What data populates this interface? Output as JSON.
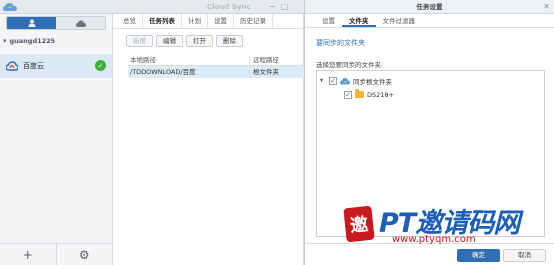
{
  "app": {
    "title": "Cloud Sync"
  },
  "sidebar": {
    "account": "guangd1225",
    "connection": {
      "name": "百度云",
      "status": "ok"
    }
  },
  "middle": {
    "tabs": [
      "总览",
      "任务列表",
      "计划",
      "设置",
      "历史记录"
    ],
    "active_tab": "任务列表",
    "toolbar": [
      "新增",
      "编辑",
      "打开",
      "删除"
    ],
    "table": {
      "columns": [
        "本地路径",
        "远程路径"
      ],
      "rows": [
        {
          "local": "/TDDOWNLOAD/百度",
          "remote": "根文件夹"
        }
      ]
    }
  },
  "dialog": {
    "title": "任务设置",
    "tabs": [
      "设置",
      "文件夹",
      "文件过滤器"
    ],
    "active_tab": "文件夹",
    "heading": "要同步的文件夹",
    "prompt": "选择您要同步的文件夹:",
    "tree": {
      "root": {
        "label": "同步根文件夹",
        "checked": true
      },
      "child": {
        "label": "DS218+",
        "checked": true
      }
    },
    "ok_label": "确定",
    "cancel_label": "取消"
  },
  "watermark": {
    "seal": "邀",
    "logo": "PT邀请码网",
    "url": "www.ptyqm.com"
  },
  "colors": {
    "accent": "#2f6fb6",
    "selection": "#dcebf8",
    "ok": "#3fae3f",
    "watermark_red": "#c8191e"
  }
}
